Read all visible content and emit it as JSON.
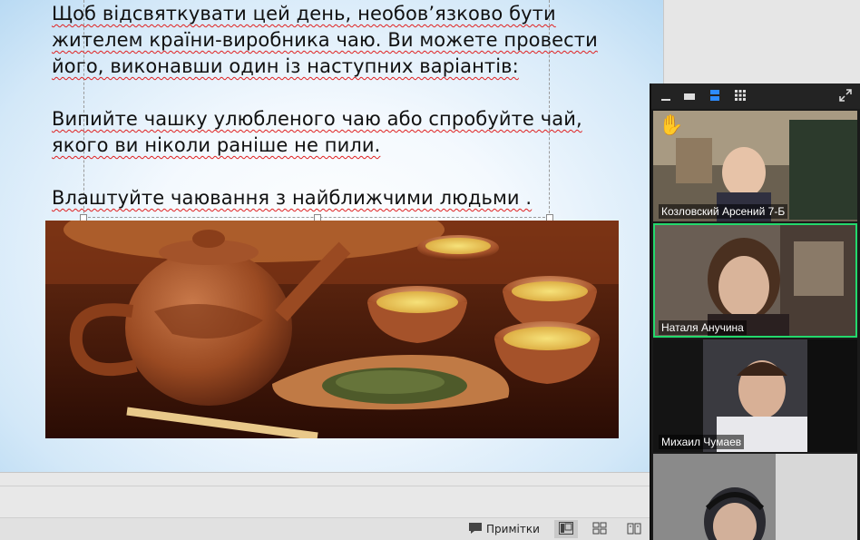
{
  "slide": {
    "lines": [
      "Щоб відсвяткувати цей день, необов’язково бути",
      "жителем країни-виробника чаю. Ви можете провести",
      "його, виконавши один із наступних варіантів:",
      "Випийте чашку улюбленого чаю або спробуйте чай,",
      "якого ви ніколи раніше не пили.",
      "Влаштуйте чаювання з найближчими людьми ."
    ],
    "image_alt": "tea-set-photo"
  },
  "statusbar": {
    "notes_label": "Примітки"
  },
  "zoom": {
    "participants": [
      {
        "name": "Козловский Арсений 7-Б",
        "hand_raised": true,
        "active": false
      },
      {
        "name": "Наталя Анучина",
        "hand_raised": false,
        "active": true
      },
      {
        "name": "Михаил Чумаев",
        "hand_raised": false,
        "active": false
      },
      {
        "name": "",
        "hand_raised": false,
        "active": false
      }
    ],
    "colors": {
      "active_border": "#23d96c",
      "toolbar_active": "#2d8cff"
    }
  }
}
